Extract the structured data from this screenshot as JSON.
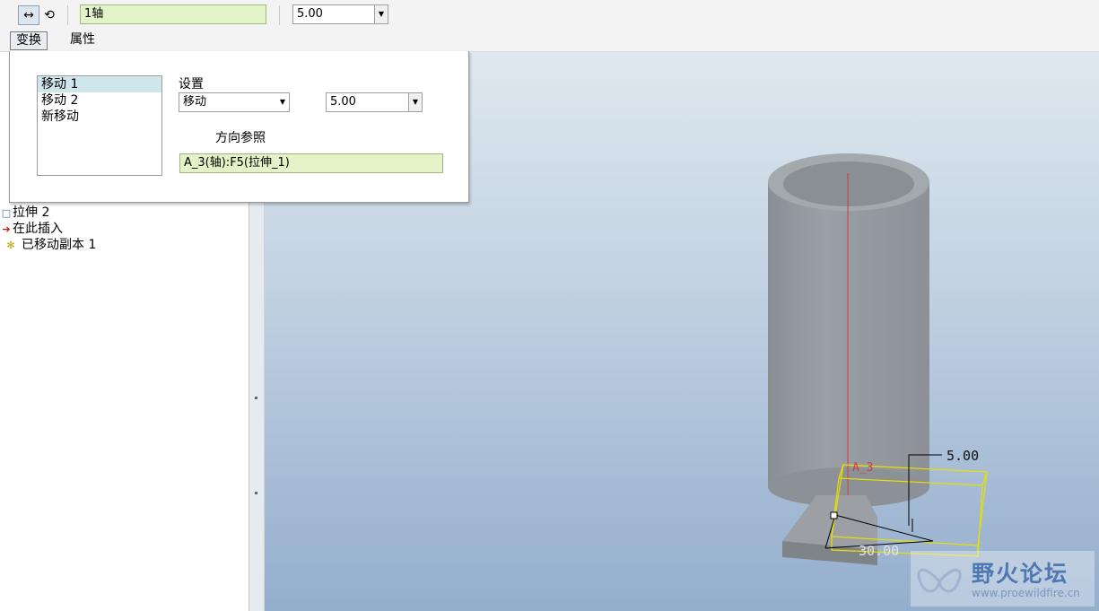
{
  "toolbar": {
    "translate_icon": "↔",
    "rotate_icon": "⟲",
    "reference_value": "1轴",
    "distance_value": "5.00"
  },
  "tabs": [
    "变换",
    "属性"
  ],
  "tree": {
    "items": [
      {
        "icon": "□",
        "label": "拉伸 2"
      },
      {
        "icon": "➔",
        "label": "在此插入"
      },
      {
        "icon": "✻",
        "label": "已移动副本 1"
      }
    ]
  },
  "panel": {
    "moves": [
      "移动 1",
      "移动 2",
      "新移动"
    ],
    "settings_label": "设置",
    "type_value": "移动",
    "value": "5.00",
    "direction_label": "方向参照",
    "direction_ref": "A_3(轴):F5(拉伸_1)"
  },
  "viewport": {
    "axis_label": "A_3",
    "dim_distance": "5.00",
    "dim_length": "30.00"
  },
  "watermark": {
    "title": "野火论坛",
    "url": "www.proewildfire.cn"
  },
  "colors": {
    "axis": "#d63a3a",
    "preview": "#e8e000",
    "field_bg": "#e4f2c8"
  }
}
